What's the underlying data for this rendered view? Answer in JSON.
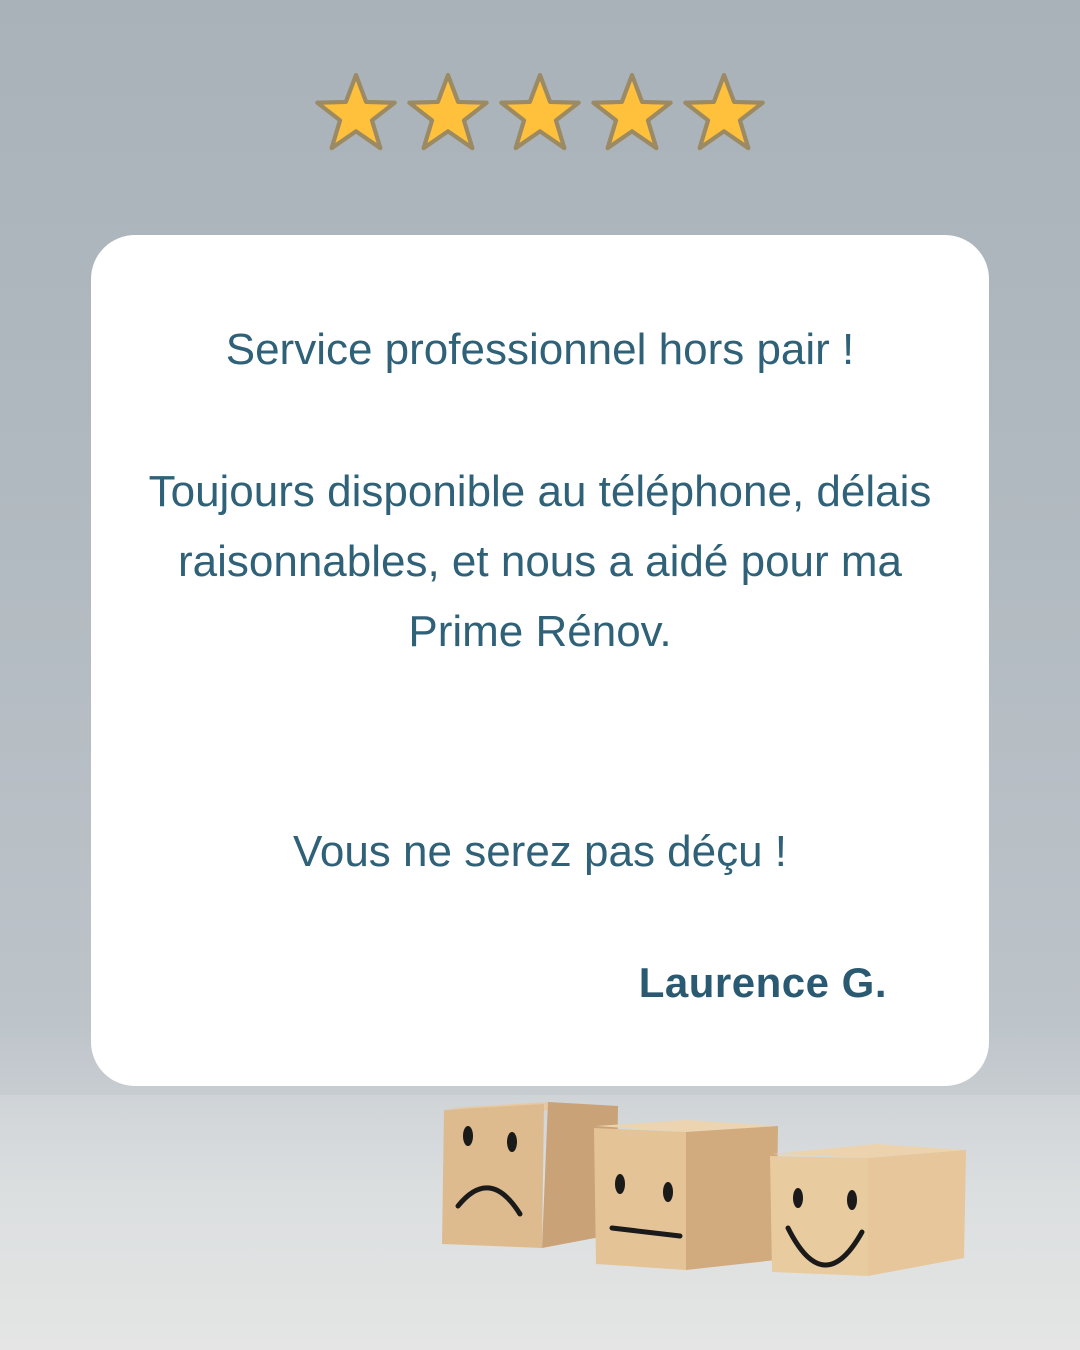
{
  "rating": {
    "stars": 5,
    "max_stars": 5,
    "star_icon": "star-icon"
  },
  "review": {
    "line1": "Service professionnel hors pair !",
    "line2": "Toujours disponible au téléphone, délais raisonnables, et nous a aidé pour ma Prime Rénov.",
    "line3": "Vous ne serez pas déçu !",
    "author": "Laurence G."
  },
  "colors": {
    "text": "#2f6178",
    "star": "#ffc13b",
    "background": "#b2bac1",
    "card": "#ffffff"
  },
  "icons": [
    "sad-face-cube-icon",
    "neutral-face-cube-icon",
    "happy-face-cube-icon"
  ]
}
